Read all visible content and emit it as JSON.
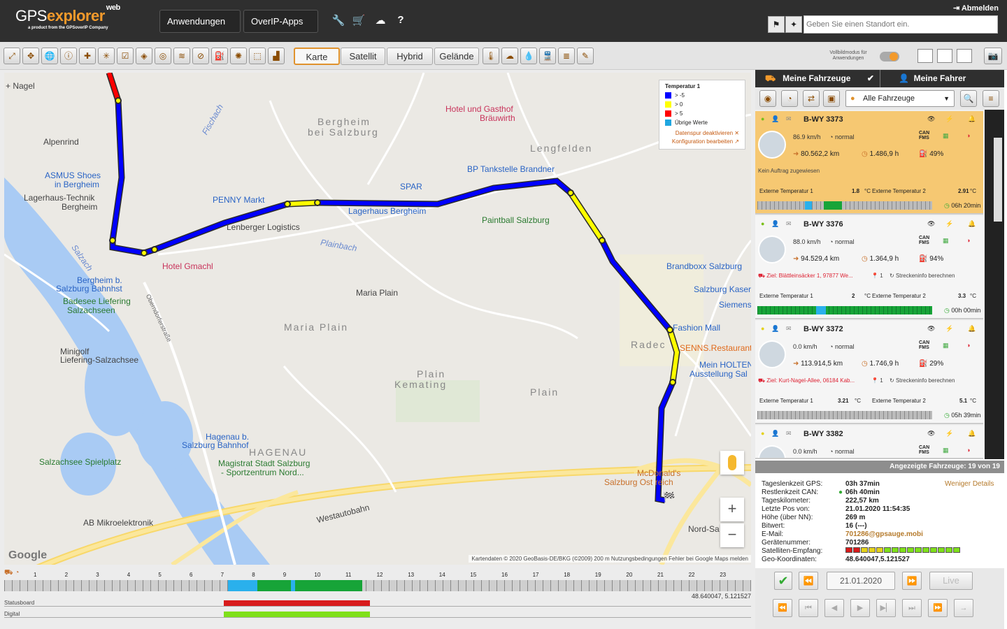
{
  "header": {
    "logo_gps": "GPS",
    "logo_explorer": "explorer",
    "logo_web": "web",
    "logo_sub": "a product from the GPSoverIP Company",
    "menus": [
      "Anwendungen",
      "OverIP-Apps"
    ],
    "logout": "Abmelden",
    "location_placeholder": "Geben Sie einen Standort ein."
  },
  "toolbar": {
    "map_types": [
      "Karte",
      "Satellit",
      "Hybrid",
      "Gelände"
    ],
    "active_map_type": "Karte",
    "fullmode_label": "Vollbildmodus für Anwendungen"
  },
  "map": {
    "legend": {
      "title": "Temperatur 1",
      "entries": [
        {
          "label": "> -5",
          "color": "#0000ff"
        },
        {
          "label": "> 0",
          "color": "#ffff00"
        },
        {
          "label": "> 5",
          "color": "#ff0000"
        },
        {
          "label": "Übrige Werte",
          "color": "#1fa6e0"
        }
      ],
      "deactivate": "Datenspur deaktivieren",
      "edit_config": "Konfiguration bearbeiten"
    },
    "labels": {
      "nagel": "Nagel",
      "alpenrind": "Alpenrind",
      "asmus": "ASMUS Shoes",
      "asmus2": "in Bergheim",
      "lagerhaus_technik": "Lagerhaus-Technik",
      "lagerhaus_technik2": "Bergheim",
      "penny": "PENNY Markt",
      "logistics": "Lenberger Logistics",
      "hotel_gmachl": "Hotel Gmachl",
      "bergheim_bf": "Bergheim b.",
      "bergheim_bf2": "Salzburg Bahnhst",
      "badesee": "Badesee Liefering",
      "badesee2": "Salzachseen",
      "minigolf": "Minigolf",
      "minigolf2": "Liefering-Salzachsee",
      "bergheim_area": "Bergheim",
      "bergheim_area2": "bei Salzburg",
      "hotel_gasthof": "Hotel und Gasthof",
      "hotel_gasthof2": "Bräuwirth",
      "lengfelden": "Lengfelden",
      "bp": "BP Tankstelle Brandner",
      "spar": "SPAR",
      "lagerhaus_bergheim": "Lagerhaus Bergheim",
      "paintball": "Paintball Salzburg",
      "maria_plain_poi": "Maria Plain",
      "maria_plain_area": "Maria Plain",
      "plain_kemating": "Plain",
      "plain_kemating2": "Kemating",
      "plain": "Plain",
      "brandboxx": "Brandboxx Salzburg",
      "salzburg_kaser": "Salzburg Kaser",
      "siemens": "Siemens",
      "fashion": "Fashion Mall",
      "radeck": "Radec",
      "senns": "SENNS.Restaurant",
      "holten": "Mein HOLTEN",
      "holten2": "Ausstellung Sal",
      "hagenau_bf": "Hagenau b.",
      "hagenau_bf2": "Salzburg Bahnhof",
      "hagenau": "HAGENAU",
      "salzachsee": "Salzachsee Spielplatz",
      "magistrat": "Magistrat Stadt Salzburg",
      "magistrat2": "- Sportzentrum Nord...",
      "ab_mikro": "AB Mikroelektronik",
      "westautobahn": "Westautobahn",
      "mcdonalds": "McDonald's",
      "mcdonalds2": "Salzburg Ost reich",
      "nord_sa": "Nord-Sa",
      "plainbach": "Plainbach",
      "salzach": "Salzach",
      "oberndorferstrasse": "Oberndorferstraße",
      "fischach": "Fischach"
    },
    "attribution": "Kartendaten © 2020 GeoBasis-DE/BKG (©2009)   200 m          Nutzungsbedingungen   Fehler bei Google Maps melden",
    "google": "Google"
  },
  "timeline": {
    "hours": [
      "1",
      "2",
      "3",
      "4",
      "5",
      "6",
      "7",
      "8",
      "9",
      "10",
      "11",
      "12",
      "13",
      "14",
      "15",
      "16",
      "17",
      "18",
      "19",
      "20",
      "21",
      "22",
      "23"
    ],
    "coord": "48.640047, 5.121527",
    "rows": [
      "Statusboard",
      "Digital"
    ]
  },
  "panel": {
    "tab_vehicles": "Meine Fahrzeuge",
    "tab_drivers": "Meine Fahrer",
    "vehicle_filter": "Alle Fahrzeuge",
    "vehicles": [
      {
        "plate": "B-WY 3373",
        "speed": "86.9 km/h",
        "status": "normal",
        "km": "80.562,2 km",
        "hours": "1.486,9 h",
        "percent": "49%",
        "info": "Kein Auftrag zugewiesen",
        "temp1_label": "Externe Temperatur 1",
        "temp1": "1.8",
        "temp2_label": "Externe Temperatur 2",
        "temp2": "2.91",
        "unit": "°C",
        "time": "06h 20min"
      },
      {
        "plate": "B-WY 3376",
        "speed": "88.0 km/h",
        "status": "normal",
        "km": "94.529,4 km",
        "hours": "1.364,9 h",
        "percent": "94%",
        "info": "Ziel: Blättleinsäcker 1, 97877 We...",
        "stops": "1",
        "route": "Streckeninfo berechnen",
        "temp1_label": "Externe Temperatur 1",
        "temp1": "2",
        "temp2_label": "Externe Temperatur 2",
        "temp2": "3.3",
        "unit": "°C",
        "time": "00h 00min"
      },
      {
        "plate": "B-WY 3372",
        "speed": "0.0 km/h",
        "status": "normal",
        "km": "113.914,5 km",
        "hours": "1.746,9 h",
        "percent": "29%",
        "info": "Ziel: Kurt-Nagel-Allee, 06184 Kab...",
        "stops": "1",
        "route": "Streckeninfo berechnen",
        "temp1_label": "Externe Temperatur 1",
        "temp1": "3.21",
        "temp2_label": "Externe Temperatur 2",
        "temp2": "5.1",
        "unit": "°C",
        "time": "05h 39min"
      },
      {
        "plate": "B-WY 3382",
        "speed": "0.0 km/h",
        "status": "normal"
      }
    ],
    "count_label": "Angezeigte Fahrzeuge: 19 von 19",
    "less_details": "Weniger Details",
    "details": [
      {
        "label": "Tageslenkzeit GPS:",
        "value": "03h 37min"
      },
      {
        "label": "Restlenkzeit CAN:",
        "value": "06h 40min"
      },
      {
        "label": "Tageskilometer:",
        "value": "222,57 km"
      },
      {
        "label": "Letzte Pos von:",
        "value": "21.01.2020 11:54:35"
      },
      {
        "label": "Höhe (über NN):",
        "value": "269 m"
      },
      {
        "label": "Bitwert:",
        "value": "16 (---)"
      },
      {
        "label": "E-Mail:",
        "value": "701286@gpsauge.mobi"
      },
      {
        "label": "Gerätenummer:",
        "value": "701286"
      },
      {
        "label": "Satelliten-Empfang:",
        "value": ""
      },
      {
        "label": "Geo-Koordinaten:",
        "value": "48.640047,5.121527"
      }
    ],
    "date": "21.01.2020",
    "live": "Live"
  }
}
